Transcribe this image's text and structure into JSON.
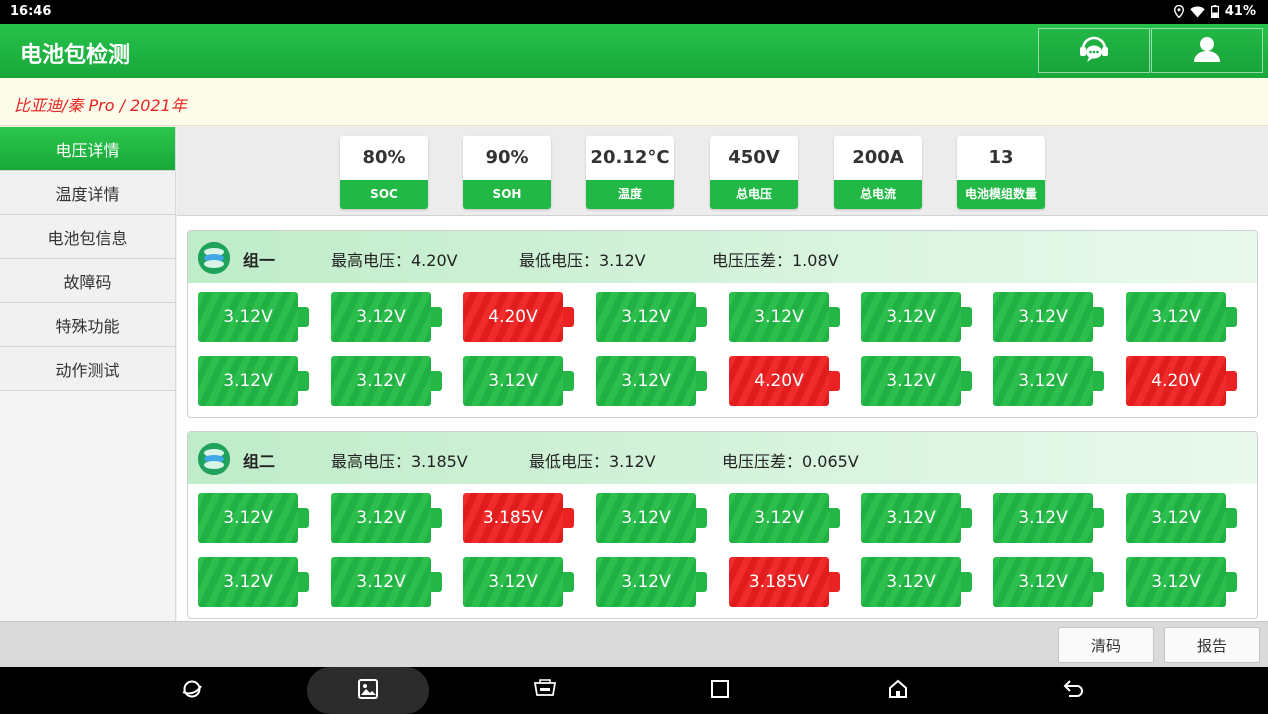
{
  "status_bar": {
    "time": "16:46",
    "battery": "41%"
  },
  "header": {
    "title": "电池包检测",
    "buttons": [
      {
        "icon": "support-chat-icon"
      },
      {
        "icon": "user-icon"
      }
    ]
  },
  "vehicle": {
    "text": "比亚迪/秦 Pro / 2021年"
  },
  "sidebar": {
    "items": [
      {
        "label": "电压详情",
        "active": true
      },
      {
        "label": "温度详情"
      },
      {
        "label": "电池包信息"
      },
      {
        "label": "故障码"
      },
      {
        "label": "特殊功能"
      },
      {
        "label": "动作测试"
      }
    ]
  },
  "stats": [
    {
      "value": "80%",
      "label": "SOC"
    },
    {
      "value": "90%",
      "label": "SOH"
    },
    {
      "value": "20.12°C",
      "label": "温度"
    },
    {
      "value": "450V",
      "label": "总电压"
    },
    {
      "value": "200A",
      "label": "总电流"
    },
    {
      "value": "13",
      "label": "电池模组数量"
    }
  ],
  "groups": [
    {
      "name": "组一",
      "max": "最高电压：4.20V",
      "min": "最低电压：3.12V",
      "diff": "电压压差：1.08V",
      "cells": [
        {
          "value": "3.12V",
          "state": "normal"
        },
        {
          "value": "3.12V",
          "state": "normal"
        },
        {
          "value": "4.20V",
          "state": "high"
        },
        {
          "value": "3.12V",
          "state": "normal"
        },
        {
          "value": "3.12V",
          "state": "normal"
        },
        {
          "value": "3.12V",
          "state": "normal"
        },
        {
          "value": "3.12V",
          "state": "normal"
        },
        {
          "value": "3.12V",
          "state": "normal"
        },
        {
          "value": "3.12V",
          "state": "normal"
        },
        {
          "value": "3.12V",
          "state": "normal"
        },
        {
          "value": "3.12V",
          "state": "normal"
        },
        {
          "value": "3.12V",
          "state": "normal"
        },
        {
          "value": "4.20V",
          "state": "high"
        },
        {
          "value": "3.12V",
          "state": "normal"
        },
        {
          "value": "3.12V",
          "state": "normal"
        },
        {
          "value": "4.20V",
          "state": "high"
        }
      ]
    },
    {
      "name": "组二",
      "max": "最高电压：3.185V",
      "min": "最低电压：3.12V",
      "diff": "电压压差：0.065V",
      "cells": [
        {
          "value": "3.12V",
          "state": "normal"
        },
        {
          "value": "3.12V",
          "state": "normal"
        },
        {
          "value": "3.185V",
          "state": "high"
        },
        {
          "value": "3.12V",
          "state": "normal"
        },
        {
          "value": "3.12V",
          "state": "normal"
        },
        {
          "value": "3.12V",
          "state": "normal"
        },
        {
          "value": "3.12V",
          "state": "normal"
        },
        {
          "value": "3.12V",
          "state": "normal"
        },
        {
          "value": "3.12V",
          "state": "normal"
        },
        {
          "value": "3.12V",
          "state": "normal"
        },
        {
          "value": "3.12V",
          "state": "normal"
        },
        {
          "value": "3.12V",
          "state": "normal"
        },
        {
          "value": "3.185V",
          "state": "high"
        },
        {
          "value": "3.12V",
          "state": "normal"
        },
        {
          "value": "3.12V",
          "state": "normal"
        },
        {
          "value": "3.12V",
          "state": "normal"
        }
      ]
    }
  ],
  "footer": {
    "clear_label": "清码",
    "report_label": "报告"
  },
  "nav": [
    {
      "icon": "browser-icon"
    },
    {
      "icon": "gallery-icon",
      "active": true
    },
    {
      "icon": "vci-icon"
    },
    {
      "icon": "recents-icon"
    },
    {
      "icon": "home-icon"
    },
    {
      "icon": "back-icon"
    }
  ],
  "colors": {
    "accent": "#22b845",
    "normal_cell": "#2dbf4d",
    "high_cell": "#f02b2b",
    "vehicle_text": "#e62525"
  }
}
